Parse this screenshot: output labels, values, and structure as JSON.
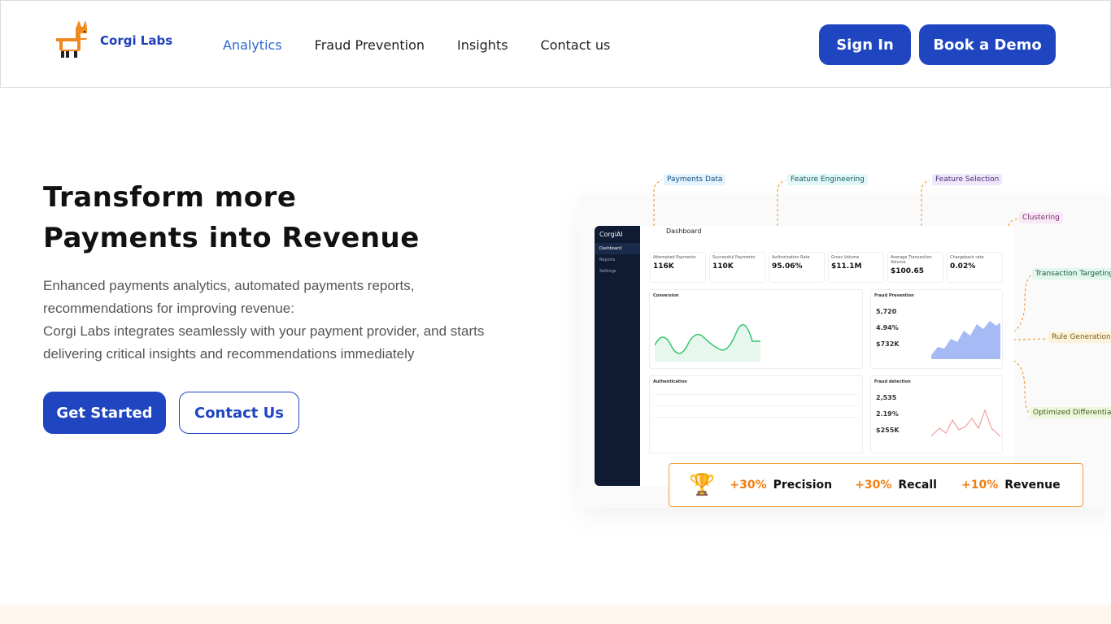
{
  "brand": {
    "name": "Corgi Labs"
  },
  "nav": {
    "items": [
      {
        "label": "Analytics",
        "active": true
      },
      {
        "label": "Fraud Prevention",
        "active": false
      },
      {
        "label": "Insights",
        "active": false
      },
      {
        "label": "Contact us",
        "active": false
      }
    ]
  },
  "header_buttons": {
    "sign_in": "Sign In",
    "book_demo": "Book a Demo"
  },
  "hero": {
    "title_line1": "Transform more",
    "title_line2": "Payments into Revenue",
    "desc_line1": "Enhanced payments analytics, automated payments reports,",
    "desc_line2": "recommendations for improving revenue:",
    "desc_line3": "Corgi Labs integrates seamlessly with your payment provider, and starts",
    "desc_line4": "delivering critical insights and recommendations immediately",
    "cta_primary": "Get Started",
    "cta_secondary": "Contact Us"
  },
  "illustration": {
    "sidebar_brand": "CorgiAI",
    "sidebar_items": [
      "Dashboard",
      "Reports",
      "Settings"
    ],
    "dashboard_title": "Dashboard",
    "kpis": [
      {
        "label": "Attempted Payments",
        "value": "116K"
      },
      {
        "label": "Successful Payments",
        "value": "110K"
      },
      {
        "label": "Authorization Rate",
        "value": "95.06%"
      },
      {
        "label": "Gross Volume",
        "value": "$11.1M"
      },
      {
        "label": "Average Transaction Volume",
        "value": "$100.65"
      },
      {
        "label": "Chargeback rate",
        "value": "0.02%"
      }
    ],
    "cards": {
      "conversion": "Conversion",
      "fraud_prevention": "Fraud Prevention",
      "fraud_values": [
        "5,720",
        "4.94%",
        "$732K"
      ],
      "authentication": "Authentication",
      "fraud_detection": "Fraud detection",
      "detection_values": [
        "2,535",
        "2.19%",
        "$255K"
      ]
    },
    "tags": {
      "payments_data": "Payments Data",
      "feature_engineering": "Feature Engineering",
      "feature_selection": "Feature Selection",
      "clustering": "Clustering",
      "transaction_targeting": "Transaction Targeting",
      "rule_generation": "Rule Generation",
      "optimized_differentiation": "Optimized Differentiation"
    },
    "metrics": [
      {
        "value": "+30%",
        "label": "Precision"
      },
      {
        "value": "+30%",
        "label": "Recall"
      },
      {
        "value": "+10%",
        "label": "Revenue"
      }
    ]
  },
  "colors": {
    "brand_blue": "#1f45c1",
    "accent_orange": "#f07e14",
    "nav_active": "#2f66d0"
  }
}
